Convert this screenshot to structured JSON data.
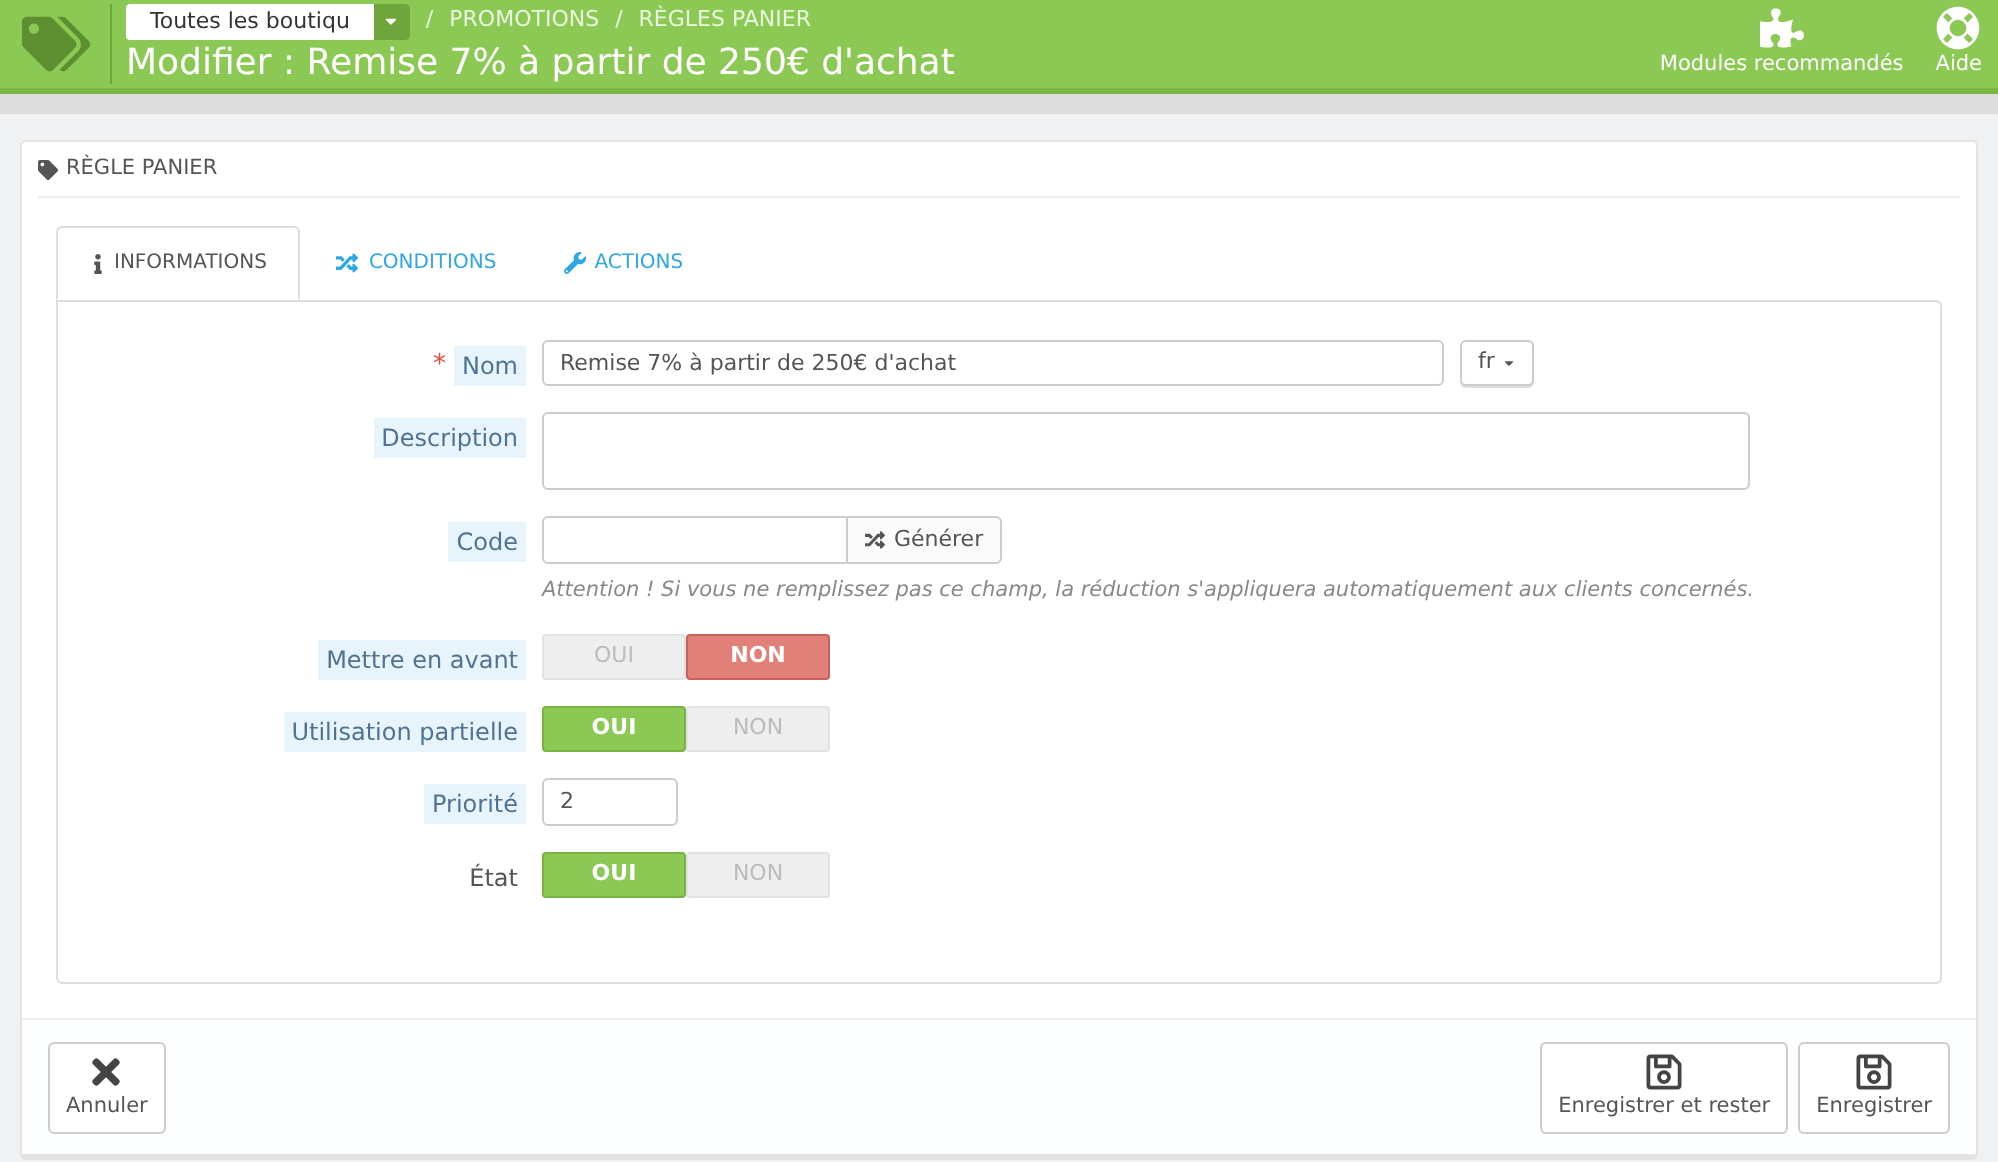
{
  "header": {
    "shop_selector": "Toutes les boutiqu",
    "breadcrumb": [
      {
        "separator": "/",
        "label": "PROMOTIONS"
      },
      {
        "separator": "/",
        "label": "RÈGLES PANIER"
      }
    ],
    "title": "Modifier : Remise 7% à partir de 250€ d'achat",
    "toolbar": [
      {
        "kind": "modules",
        "label": "Modules recommandés"
      },
      {
        "kind": "help",
        "label": "Aide"
      }
    ]
  },
  "panel": {
    "title": "RÈGLE PANIER"
  },
  "tabs": [
    {
      "kind": "info",
      "label": "INFORMATIONS",
      "selected": true
    },
    {
      "kind": "conditions",
      "label": "CONDITIONS",
      "selected": false
    },
    {
      "kind": "actions",
      "label": "ACTIONS",
      "selected": false
    }
  ],
  "fields": [
    {
      "kind": "text",
      "label": "Nom",
      "required_mark": "*",
      "hint": true,
      "value": "Remise 7% à partir de 250€ d'achat",
      "lang": "fr"
    },
    {
      "kind": "textarea",
      "label": "Description",
      "hint": true
    },
    {
      "kind": "code",
      "label": "Code",
      "hint": true,
      "button": "Générer",
      "help": "Attention ! Si vous ne remplissez pas ce champ, la réduction s'appliquera automatiquement aux clients concernés."
    },
    {
      "kind": "switch",
      "label": "Mettre en avant",
      "hint": true,
      "options": [
        {
          "label": "OUI",
          "selected": false
        },
        {
          "label": "NON",
          "selected": true
        }
      ]
    },
    {
      "kind": "switch",
      "label": "Utilisation partielle",
      "hint": true,
      "options": [
        {
          "label": "OUI",
          "selected": true
        },
        {
          "label": "NON",
          "selected": false
        }
      ]
    },
    {
      "kind": "small",
      "label": "Priorité",
      "hint": true,
      "value": "2"
    },
    {
      "kind": "switch",
      "label": "État",
      "hint": false,
      "options": [
        {
          "label": "OUI",
          "selected": true
        },
        {
          "label": "NON",
          "selected": false
        }
      ]
    }
  ],
  "footer": [
    {
      "kind": "cancel",
      "label": "Annuler"
    },
    {
      "kind": "save",
      "label": "Enregistrer et rester"
    },
    {
      "kind": "save",
      "label": "Enregistrer"
    }
  ]
}
